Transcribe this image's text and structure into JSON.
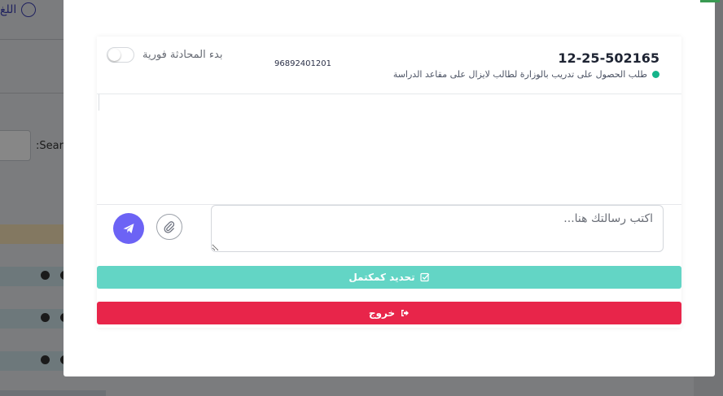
{
  "background": {
    "language_label": "اللغ",
    "search_label": ":Searc"
  },
  "chat": {
    "ref_number": "12-25-502165",
    "subtitle": "طلب الحصول على تدريب بالوزارة لطالب لايزال على مقاعد الدراسة",
    "status_color": "#15b48a",
    "phone": "96892401201",
    "live_chat_label": "بدء المحادثة فورية",
    "live_chat_enabled": false
  },
  "composer": {
    "placeholder": "اكتب رسالتك هنا...",
    "value": "",
    "attach_icon": "paperclip-icon",
    "send_icon": "paper-plane-icon"
  },
  "actions": {
    "complete_label": "تحديد كمكتمل",
    "complete_icon": "check-square-icon",
    "complete_color": "#63d5c5",
    "exit_label": "خروج",
    "exit_icon": "sign-out-icon",
    "exit_color": "#e8254a"
  }
}
